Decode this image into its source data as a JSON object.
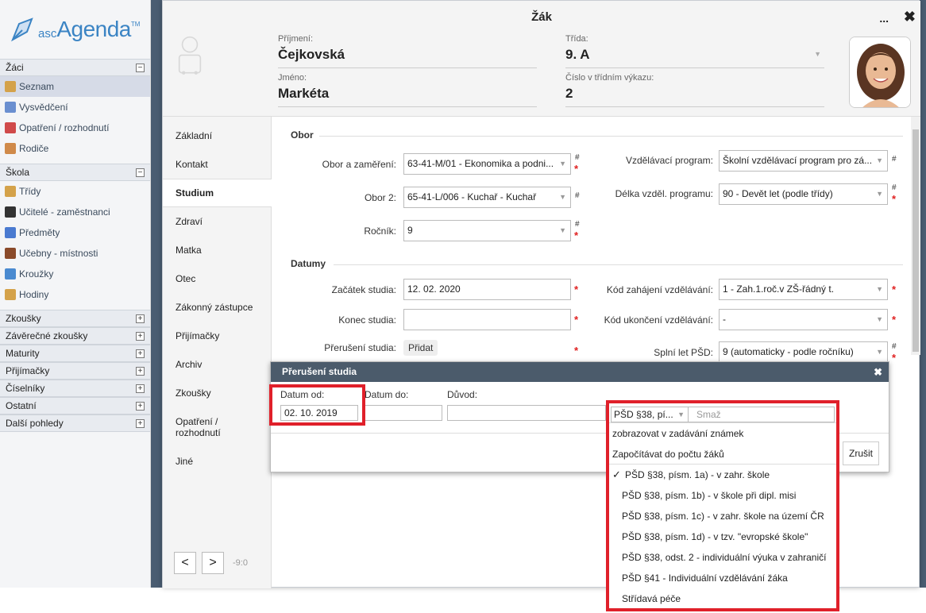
{
  "sidebar": {
    "logo_prefix": "asc",
    "logo_name": "Agenda",
    "logo_tm": "TM",
    "sections": [
      {
        "label": "Žáci",
        "toggle": "−",
        "items": [
          {
            "label": "Seznam",
            "icon": "student-icon",
            "color": "#d4a24a",
            "active": true
          },
          {
            "label": "Vysvědčení",
            "icon": "certificate-icon",
            "color": "#6a8fd0"
          },
          {
            "label": "Opatření / rozhodnutí",
            "icon": "pin-icon",
            "color": "#d04a4a"
          },
          {
            "label": "Rodiče",
            "icon": "parents-icon",
            "color": "#d08a4a"
          }
        ]
      },
      {
        "label": "Škola",
        "toggle": "−",
        "items": [
          {
            "label": "Třídy",
            "icon": "class-icon",
            "color": "#d4a24a"
          },
          {
            "label": "Učitelé - zaměstnanci",
            "icon": "teacher-icon",
            "color": "#333333"
          },
          {
            "label": "Předměty",
            "icon": "subjects-icon",
            "color": "#4a7ad0"
          },
          {
            "label": "Učebny - místnosti",
            "icon": "room-icon",
            "color": "#8a4a2a"
          },
          {
            "label": "Kroužky",
            "icon": "club-icon",
            "color": "#4a8ad0"
          },
          {
            "label": "Hodiny",
            "icon": "lessons-icon",
            "color": "#d4a24a"
          }
        ]
      },
      {
        "label": "Zkoušky",
        "toggle": "+",
        "items": []
      },
      {
        "label": "Závěrečné zkoušky",
        "toggle": "+",
        "items": []
      },
      {
        "label": "Maturity",
        "toggle": "+",
        "items": []
      },
      {
        "label": "Přijímačky",
        "toggle": "+",
        "items": []
      },
      {
        "label": "Číselníky",
        "toggle": "+",
        "items": []
      },
      {
        "label": "Ostatní",
        "toggle": "+",
        "items": []
      },
      {
        "label": "Další pohledy",
        "toggle": "+",
        "items": []
      }
    ]
  },
  "dialog": {
    "title": "Žák",
    "more": "...",
    "close": "✖",
    "surname_label": "Příjmení:",
    "surname": "Čejkovská",
    "name_label": "Jméno:",
    "name": "Markéta",
    "class_label": "Třída:",
    "class": "9. A",
    "number_label": "Číslo v třídním výkazu:",
    "number": "2"
  },
  "tabs": [
    "Základní",
    "Kontakt",
    "Studium",
    "Zdraví",
    "Matka",
    "Otec",
    "Zákonný zástupce",
    "Přijímačky",
    "Archiv",
    "Zkoušky",
    "Opatření / rozhodnutí",
    "Jiné"
  ],
  "active_tab": "Studium",
  "nav": {
    "prev": "<",
    "next": ">",
    "info": "-9:0"
  },
  "obor": {
    "group": "Obor",
    "obor_label": "Obor a zaměření:",
    "obor_value": "63-41-M/01 - Ekonomika a podni...",
    "obor2_label": "Obor 2:",
    "obor2_value": "65-41-L/006 - Kuchař - Kuchař",
    "rocnik_label": "Ročník:",
    "rocnik_value": "9",
    "program_label": "Vzdělávací program:",
    "program_value": "Školní vzdělávací program pro zá...",
    "delka_label": "Délka vzděl. programu:",
    "delka_value": "90 - Devět let (podle třídy)"
  },
  "datumy": {
    "group": "Datumy",
    "zacatek_label": "Začátek studia:",
    "zacatek_value": "12. 02. 2020",
    "konec_label": "Konec studia:",
    "konec_value": "",
    "preruseni_label": "Přerušení studia:",
    "preruseni_btn": "Přidat",
    "kod_zahajeni_label": "Kód zahájení vzdělávání:",
    "kod_zahajeni_value": "1 - Zah.1.roč.v ZŠ-řádný t.",
    "kod_ukonceni_label": "Kód ukončení vzdělávání:",
    "kod_ukonceni_value": "-",
    "psd_label": "Splní let PŠD:",
    "psd_value": "9 (automaticky - podle ročníku)"
  },
  "sub": {
    "title": "Přerušení studia",
    "close": "✖",
    "od_label": "Datum od:",
    "od_value": "02. 10. 2019",
    "do_label": "Datum do:",
    "do_value": "",
    "duvod_label": "Důvod:",
    "duvod_value": "",
    "zrusit": "Zrušit"
  },
  "dropdown": {
    "selected": "PŠD §38, pí...",
    "smaz": "Smaž",
    "options": [
      {
        "label": "zobrazovat v zadávání známek",
        "type": "plain"
      },
      {
        "label": "Započítávat do počtu žáků",
        "type": "plain",
        "sep": true
      },
      {
        "label": "PŠD §38, písm. 1a) - v zahr. škole",
        "type": "checked"
      },
      {
        "label": "PŠD §38, písm. 1b) - v škole při dipl. misi",
        "type": "ind"
      },
      {
        "label": "PŠD §38, písm. 1c) - v zahr. škole na území ČR",
        "type": "ind"
      },
      {
        "label": "PŠD §38, písm. 1d) - v tzv. \"evropské škole\"",
        "type": "ind"
      },
      {
        "label": "PŠD §38, odst. 2 - individuální výuka v zahraničí",
        "type": "ind"
      },
      {
        "label": "PŠD §41 - Individuální vzdělávání žáka",
        "type": "ind"
      },
      {
        "label": "Střídavá péče",
        "type": "ind"
      }
    ]
  },
  "colors": {
    "accent": "#3b84c4",
    "required": "#e02020",
    "highlight": "#e0202a",
    "subbar": "#4b5b6b"
  }
}
